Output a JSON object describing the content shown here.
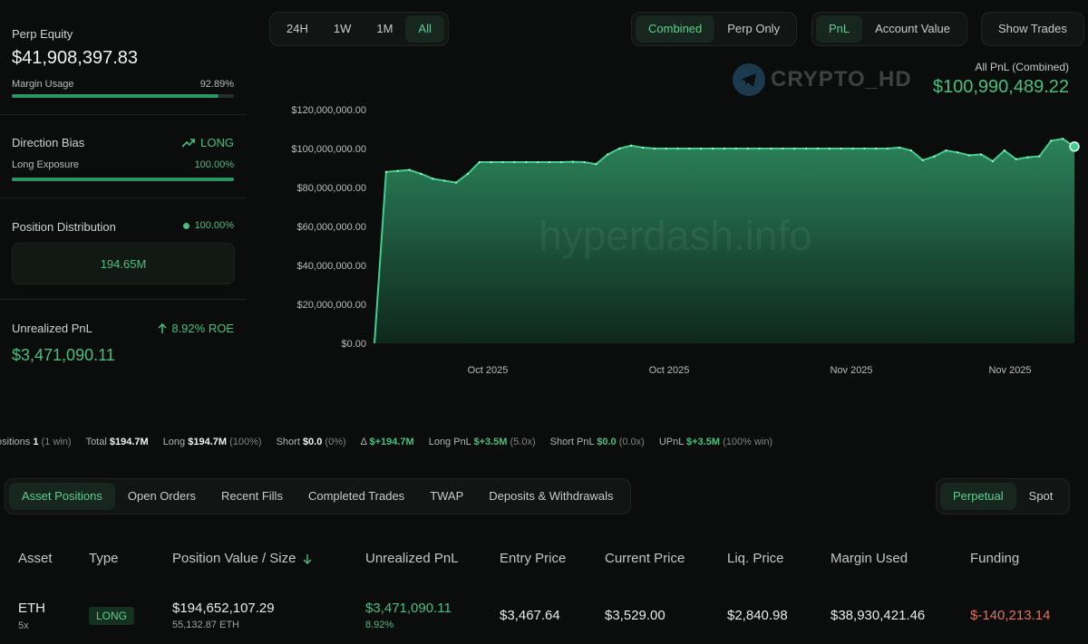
{
  "left": {
    "perp_equity_label": "Perp Equity",
    "perp_equity_value": "$41,908,397.83",
    "margin_usage_label": "Margin Usage",
    "margin_usage_value": "92.89%",
    "margin_usage_fraction": 0.9289,
    "direction_bias_label": "Direction Bias",
    "direction_bias_value": "LONG",
    "long_exposure_label": "Long Exposure",
    "long_exposure_value": "100.00%",
    "long_exposure_fraction": 1.0,
    "position_distribution_label": "Position Distribution",
    "position_distribution_value": "100.00%",
    "position_distribution_amount": "194.65M",
    "unrealized_pnl_label": "Unrealized PnL",
    "unrealized_roe": "8.92% ROE",
    "unrealized_pnl_value": "$3,471,090.11"
  },
  "range_tabs": [
    "24H",
    "1W",
    "1M",
    "All"
  ],
  "range_active": 3,
  "mode_tabs": [
    "Combined",
    "Perp Only"
  ],
  "mode_active": 0,
  "metric_tabs": [
    "PnL",
    "Account Value"
  ],
  "metric_active": 0,
  "show_trades_label": "Show Trades",
  "watermark_logo": "CRYPTO_HD",
  "watermark_site": "hyperdash.info",
  "all_pnl_label": "All PnL (Combined)",
  "all_pnl_value": "$100,990,489.22",
  "chart_data": {
    "type": "area",
    "y_tick_labels": [
      "$120,000,000.00",
      "$100,000,000.00",
      "$80,000,000.00",
      "$60,000,000.00",
      "$40,000,000.00",
      "$20,000,000.00",
      "$0.00"
    ],
    "ylim": [
      0,
      120000000
    ],
    "x_tick_labels": [
      "Oct 2025",
      "Oct 2025",
      "Nov 2025",
      "Nov 2025"
    ],
    "values": [
      0,
      88000000,
      88500000,
      89000000,
      87000000,
      84500000,
      83500000,
      82500000,
      87000000,
      93000000,
      93000000,
      93000000,
      93000000,
      93000000,
      93000000,
      93000000,
      93000000,
      93200000,
      93000000,
      92000000,
      97000000,
      100000000,
      101500000,
      100500000,
      100000000,
      100000000,
      100000000,
      100000000,
      100000000,
      100000000,
      100000000,
      100000000,
      100000000,
      100000000,
      100000000,
      100000000,
      100000000,
      100000000,
      100000000,
      100000000,
      100000000,
      100000000,
      100000000,
      100000000,
      100000000,
      100500000,
      99000000,
      94000000,
      96000000,
      99000000,
      98000000,
      96500000,
      97000000,
      93500000,
      99000000,
      94500000,
      95500000,
      96000000,
      104000000,
      105000000,
      101000000
    ],
    "color": "#3fcf8e"
  },
  "stats": {
    "positions_label": "ositions",
    "positions_count": "1",
    "positions_win": "(1 win)",
    "total_label": "Total",
    "total_value": "$194.7M",
    "long_label": "Long",
    "long_value": "$194.7M",
    "long_pct": "(100%)",
    "short_label": "Short",
    "short_value": "$0.0",
    "short_pct": "(0%)",
    "delta_label": "Δ",
    "delta_value": "$+194.7M",
    "long_pnl_label": "Long PnL",
    "long_pnl_value": "$+3.5M",
    "long_pnl_x": "(5.0x)",
    "short_pnl_label": "Short PnL",
    "short_pnl_value": "$0.0",
    "short_pnl_x": "(0.0x)",
    "upnl_label": "UPnL",
    "upnl_value": "$+3.5M",
    "upnl_win": "(100% win)"
  },
  "bottom_tabs": [
    "Asset Positions",
    "Open Orders",
    "Recent Fills",
    "Completed Trades",
    "TWAP",
    "Deposits & Withdrawals"
  ],
  "bottom_active": 0,
  "market_tabs": [
    "Perpetual",
    "Spot"
  ],
  "market_active": 0,
  "table": {
    "headers": [
      "Asset",
      "Type",
      "Position Value / Size",
      "Unrealized PnL",
      "Entry Price",
      "Current Price",
      "Liq. Price",
      "Margin Used",
      "Funding"
    ],
    "rows": [
      {
        "asset": "ETH",
        "leverage": "5x",
        "type": "LONG",
        "position_value": "$194,652,107.29",
        "position_size": "55,132.87 ETH",
        "unrealized_pnl": "$3,471,090.11",
        "unrealized_pct": "8.92%",
        "entry_price": "$3,467.64",
        "current_price": "$3,529.00",
        "liq_price": "$2,840.98",
        "margin_used": "$38,930,421.46",
        "funding": "$-140,213.14"
      }
    ]
  },
  "colors": {
    "accent_green": "#46c07f",
    "funding_red": "#e2705f",
    "background": "#0b0d0c"
  }
}
